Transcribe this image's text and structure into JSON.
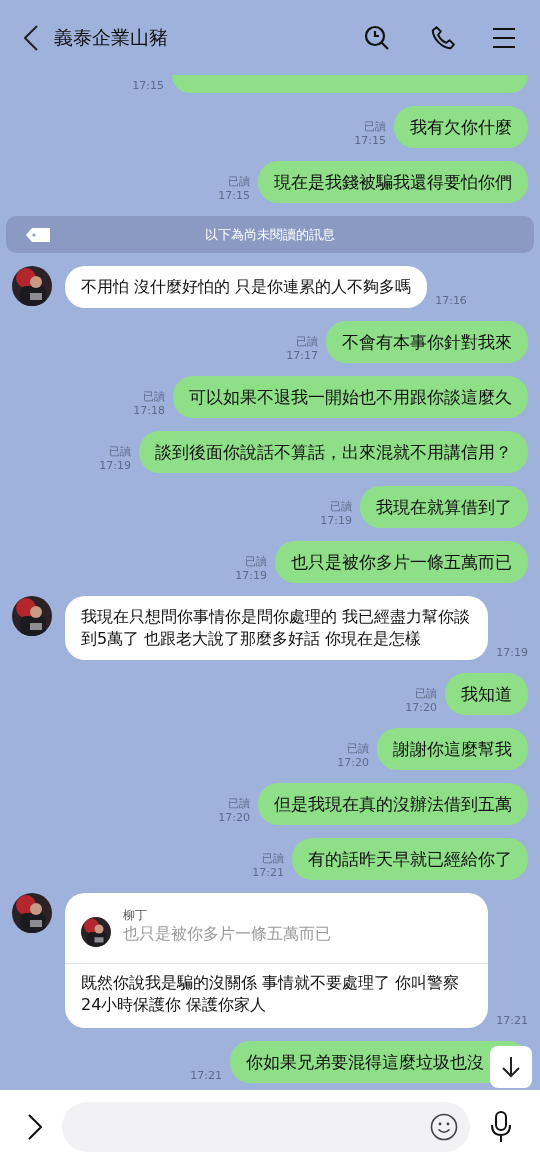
{
  "header": {
    "title": "義泰企業山豬"
  },
  "messages": [
    {
      "kind": "partial",
      "time": "17:15"
    },
    {
      "kind": "outgoing",
      "text": "我有欠你什麼",
      "read": "已讀",
      "time": "17:15"
    },
    {
      "kind": "outgoing",
      "text": "現在是我錢被騙我還得要怕你們",
      "read": "已讀",
      "time": "17:15"
    },
    {
      "kind": "divider",
      "text": "以下為尚未閱讀的訊息"
    },
    {
      "kind": "incoming",
      "text": "不用怕 沒什麼好怕的 只是你連累的人不夠多嗎",
      "time": "17:16"
    },
    {
      "kind": "outgoing",
      "text": "不會有本事你針對我來",
      "read": "已讀",
      "time": "17:17"
    },
    {
      "kind": "outgoing",
      "text": "可以如果不退我一開始也不用跟你談這麼久",
      "read": "已讀",
      "time": "17:18"
    },
    {
      "kind": "outgoing",
      "text": "談到後面你說話不算話，出來混就不用講信用？",
      "read": "已讀",
      "time": "17:19"
    },
    {
      "kind": "outgoing",
      "text": "我現在就算借到了",
      "read": "已讀",
      "time": "17:19"
    },
    {
      "kind": "outgoing",
      "text": "也只是被你多片一條五萬而已",
      "read": "已讀",
      "time": "17:19"
    },
    {
      "kind": "incoming",
      "text": "我現在只想問你事情你是問你處理的 我已經盡力幫你談到5萬了 也跟老大說了那麼多好話 你現在是怎樣",
      "time": "17:19"
    },
    {
      "kind": "outgoing",
      "text": "我知道",
      "read": "已讀",
      "time": "17:20"
    },
    {
      "kind": "outgoing",
      "text": "謝謝你這麼幫我",
      "read": "已讀",
      "time": "17:20"
    },
    {
      "kind": "outgoing",
      "text": "但是我現在真的沒辦法借到五萬",
      "read": "已讀",
      "time": "17:20"
    },
    {
      "kind": "outgoing",
      "text": "有的話昨天早就已經給你了",
      "read": "已讀",
      "time": "17:21"
    },
    {
      "kind": "incoming",
      "quote": {
        "name": "柳丁",
        "text": "也只是被你多片一條五萬而已"
      },
      "text": "既然你說我是騙的沒關係 事情就不要處理了 你叫警察24小時保護你 保護你家人",
      "time": "17:21"
    },
    {
      "kind": "outgoing",
      "text": "你如果兄弟要混得這麼垃圾也沒",
      "time": "17:21"
    }
  ]
}
